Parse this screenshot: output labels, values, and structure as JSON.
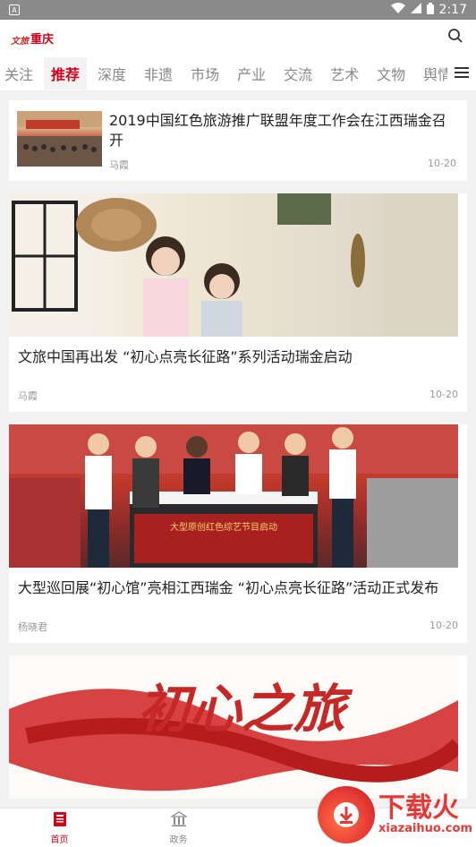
{
  "status_bar": {
    "time": "2:17"
  },
  "app": {
    "logo_text": "重庆",
    "logo_mark": "文旅"
  },
  "tabs": [
    {
      "label": "关注",
      "active": false
    },
    {
      "label": "推荐",
      "active": true
    },
    {
      "label": "深度",
      "active": false
    },
    {
      "label": "非遗",
      "active": false
    },
    {
      "label": "市场",
      "active": false
    },
    {
      "label": "产业",
      "active": false
    },
    {
      "label": "交流",
      "active": false
    },
    {
      "label": "艺术",
      "active": false
    },
    {
      "label": "文物",
      "active": false
    },
    {
      "label": "舆情",
      "active": false
    }
  ],
  "articles": [
    {
      "title": "2019中国红色旅游推广联盟年度工作会在江西瑞金召开",
      "author": "马霞",
      "date": "10-20",
      "layout": "small"
    },
    {
      "title": "文旅中国再出发 “初心点亮长征路”系列活动瑞金启动",
      "author": "马霞",
      "date": "10-20",
      "layout": "big"
    },
    {
      "title": "大型巡回展“初心馆”亮相江西瑞金 “初心点亮长征路”活动正式发布",
      "author": "杨晓君",
      "date": "10-20",
      "layout": "big"
    },
    {
      "image_text": "初心之旅",
      "layout": "big"
    }
  ],
  "slate_text": "大型原创红色综艺节目启动",
  "bottom_nav": [
    {
      "label": "首页",
      "icon": "newspaper-icon",
      "active": true
    },
    {
      "label": "政务",
      "icon": "government-building-icon",
      "active": false
    }
  ],
  "watermark": {
    "title": "下载火",
    "subtitle": "xiazaihuo.com"
  },
  "colors": {
    "accent": "#d0021b",
    "status_bar": "#8a8a8a"
  }
}
